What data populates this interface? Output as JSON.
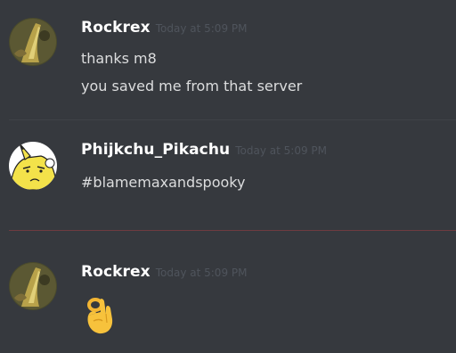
{
  "messages": [
    {
      "username": "Rockrex",
      "timestamp": "Today at 5:09 PM",
      "lines": [
        "thanks m8",
        "you saved me from that server"
      ]
    },
    {
      "username": "Phijkchu_Pikachu",
      "timestamp": "Today at 5:09 PM",
      "lines": [
        "#blamemaxandspooky"
      ]
    },
    {
      "username": "Rockrex",
      "timestamp": "Today at 5:09 PM",
      "emoji": "ok-hand-emoji"
    }
  ],
  "colors": {
    "background": "#36393e",
    "username": "#ffffff",
    "timestamp": "#4f545c",
    "message_text": "#dcddde",
    "new_messages_divider": "#6f3b40"
  }
}
